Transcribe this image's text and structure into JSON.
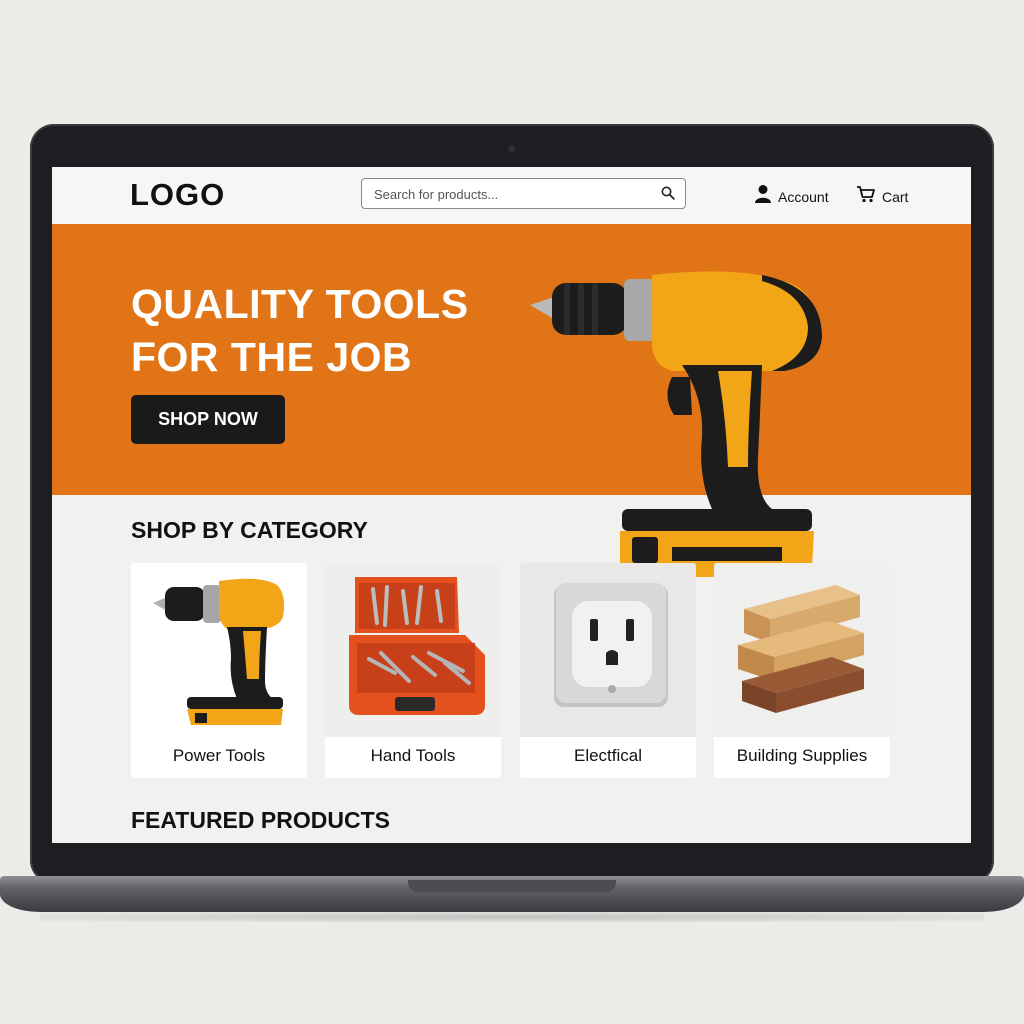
{
  "header": {
    "logo": "LOGO",
    "search_placeholder": "Search for products...",
    "account_label": "Account",
    "cart_label": "Cart"
  },
  "hero": {
    "title_line1": "QUALITY TOOLS",
    "title_line2": "FOR THE JOB",
    "cta_label": "SHOP NOW"
  },
  "categories": {
    "title": "SHOP BY CATEGORY",
    "items": [
      {
        "label": "Power Tools",
        "icon": "drill-icon"
      },
      {
        "label": "Hand Tools",
        "icon": "toolbox-icon"
      },
      {
        "label": "Electfical",
        "icon": "outlet-icon"
      },
      {
        "label": "Building Supplies",
        "icon": "lumber-icon"
      }
    ]
  },
  "featured": {
    "title": "FEATURED PRODUCTS"
  },
  "colors": {
    "accent": "#e07416",
    "button": "#1a1a1a",
    "tool_yellow": "#f2a516"
  }
}
